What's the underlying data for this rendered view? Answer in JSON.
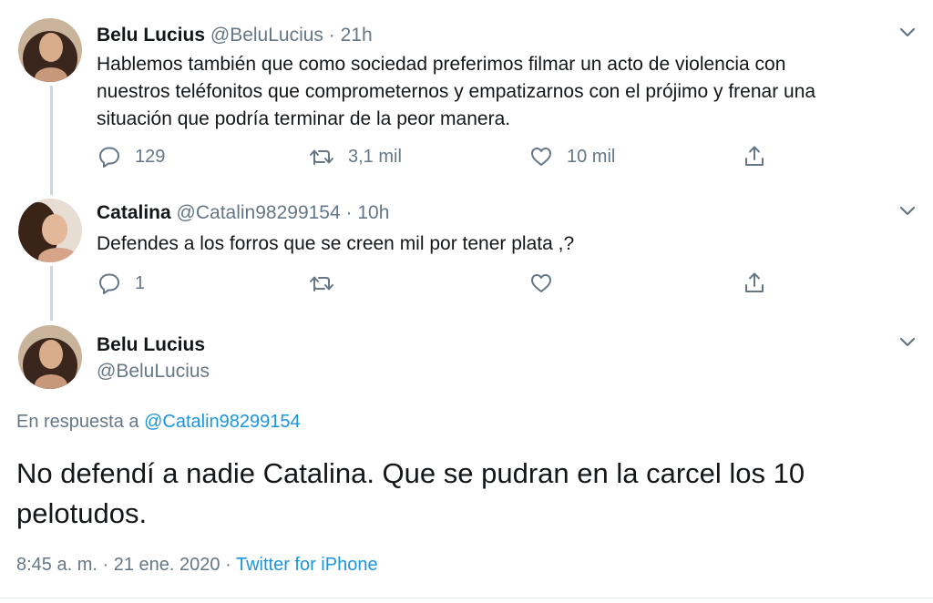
{
  "tweets": [
    {
      "name": "Belu Lucius",
      "handle": "@BeluLucius",
      "sep": "·",
      "time": "21h",
      "text_lines": [
        "Hablemos también que como sociedad preferimos filmar un acto de violencia con",
        "nuestros teléfonitos que comprometernos y empatizarnos con el prójimo y frenar una",
        "situación que podría terminar de la peor manera."
      ],
      "replies": "129",
      "retweets": "3,1 mil",
      "likes": "10 mil"
    },
    {
      "name": "Catalina",
      "handle": "@Catalin98299154",
      "sep": "·",
      "time": "10h",
      "text_lines": [
        "Defendes a los forros que se creen mil por tener plata ,?"
      ],
      "replies": "1",
      "retweets": "",
      "likes": ""
    }
  ],
  "main": {
    "name": "Belu Lucius",
    "handle": "@BeluLucius",
    "reply_prefix": "En respuesta a",
    "reply_to": "@Catalin98299154",
    "text_lines": [
      "No defendí a nadie Catalina. Que se pudran en la carcel los 10",
      "pelotudos."
    ],
    "time": "8:45 a. m.",
    "sep1": "·",
    "date": "21 ene. 2020",
    "sep2": "·",
    "source": "Twitter for iPhone"
  },
  "icons": [
    "reply-icon",
    "retweet-icon",
    "like-icon",
    "share-icon",
    "chevron-down-icon"
  ],
  "colors": {
    "text": "#14171a",
    "secondary": "#657786",
    "link": "#1b95e0",
    "thread_line": "#ccd6dd"
  }
}
